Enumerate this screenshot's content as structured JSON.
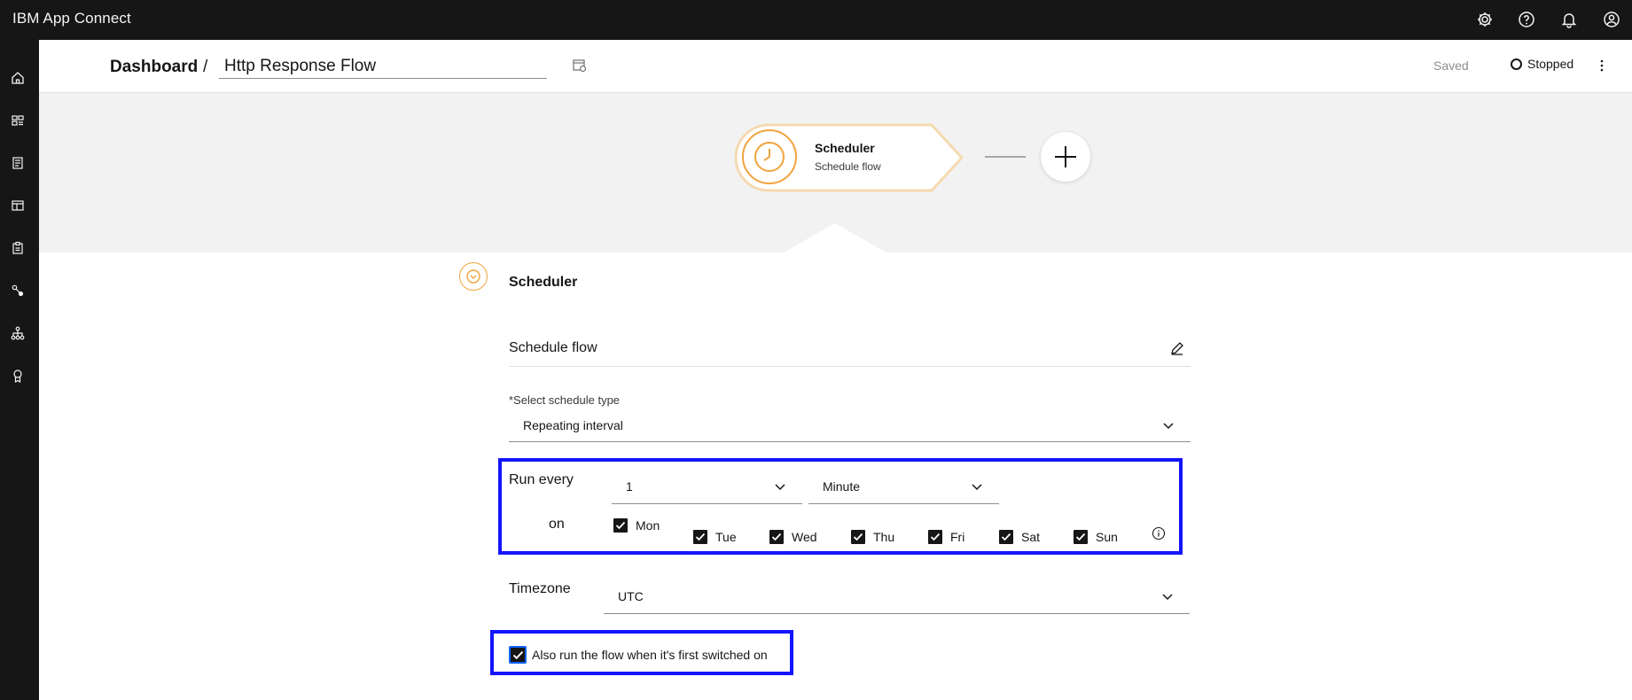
{
  "header": {
    "brand": "IBM App Connect",
    "icons": [
      "settings-icon",
      "help-icon",
      "notification-icon",
      "user-avatar-icon"
    ]
  },
  "sidenav": {
    "items": [
      "home-icon",
      "catalog-icon",
      "document-icon",
      "templates-icon",
      "clipboard-icon",
      "connections-icon",
      "hierarchy-icon",
      "badge-icon"
    ]
  },
  "titlebar": {
    "breadcrumb": "Dashboard",
    "separator": "/",
    "flow_name": "Http Response Flow",
    "saved": "Saved",
    "status": "Stopped"
  },
  "canvas": {
    "node": {
      "title": "Scheduler",
      "subtitle": "Schedule flow"
    }
  },
  "panel": {
    "title": "Scheduler",
    "schedule_name": "Schedule flow",
    "schedule_type_label": "*Select schedule type",
    "schedule_type_value": "Repeating interval",
    "run_every_label": "Run every",
    "interval_value": "1",
    "interval_unit": "Minute",
    "on_label": "on",
    "days": [
      {
        "label": "Mon",
        "checked": true
      },
      {
        "label": "Tue",
        "checked": true
      },
      {
        "label": "Wed",
        "checked": true
      },
      {
        "label": "Thu",
        "checked": true
      },
      {
        "label": "Fri",
        "checked": true
      },
      {
        "label": "Sat",
        "checked": true
      },
      {
        "label": "Sun",
        "checked": true
      }
    ],
    "timezone_label": "Timezone",
    "timezone_value": "UTC",
    "first_run_label": "Also run the flow when it's first switched on",
    "first_run_checked": true
  },
  "colors": {
    "header_bg": "#161616",
    "canvas_bg": "#f2f2f2",
    "scheduler_accent": "#f1a33c",
    "highlight": "#1414ff"
  }
}
